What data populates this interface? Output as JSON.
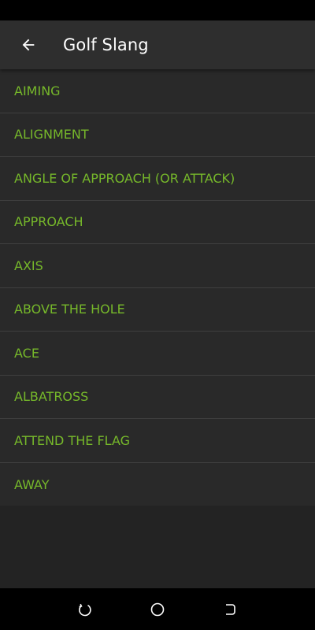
{
  "app_bar": {
    "title": "Golf Slang"
  },
  "list": {
    "items": [
      {
        "label": "AIMING"
      },
      {
        "label": "ALIGNMENT"
      },
      {
        "label": "ANGLE OF APPROACH (OR ATTACK)"
      },
      {
        "label": "APPROACH"
      },
      {
        "label": "AXIS"
      },
      {
        "label": "ABOVE THE HOLE"
      },
      {
        "label": "ACE"
      },
      {
        "label": "ALBATROSS"
      },
      {
        "label": "ATTEND THE FLAG"
      },
      {
        "label": "AWAY"
      }
    ]
  },
  "colors": {
    "accent": "#76b82a",
    "app_bar_bg": "#2e2e2e",
    "list_bg": "#292929",
    "divider": "#3f3f3f"
  },
  "icons": {
    "back": "arrow-left-icon",
    "nav_recents": "recents-icon",
    "nav_home": "home-icon",
    "nav_back": "back-icon"
  }
}
